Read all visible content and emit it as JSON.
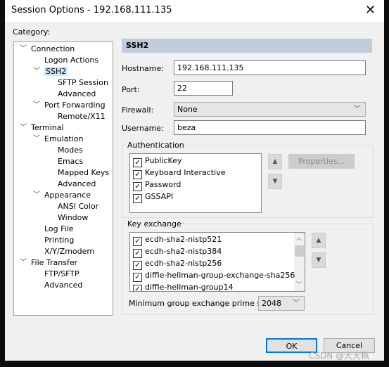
{
  "window": {
    "title": "Session Options - 192.168.111.135",
    "close_icon": "close-icon"
  },
  "category_label": "Category:",
  "tree": [
    {
      "label": "Connection",
      "level": 0,
      "expanded": true
    },
    {
      "label": "Logon Actions",
      "level": 1
    },
    {
      "label": "SSH2",
      "level": 1,
      "expanded": true,
      "selected": true
    },
    {
      "label": "SFTP Session",
      "level": 2
    },
    {
      "label": "Advanced",
      "level": 2
    },
    {
      "label": "Port Forwarding",
      "level": 1,
      "expanded": true
    },
    {
      "label": "Remote/X11",
      "level": 2
    },
    {
      "label": "Terminal",
      "level": 0,
      "expanded": true
    },
    {
      "label": "Emulation",
      "level": 1,
      "expanded": true
    },
    {
      "label": "Modes",
      "level": 2
    },
    {
      "label": "Emacs",
      "level": 2
    },
    {
      "label": "Mapped Keys",
      "level": 2
    },
    {
      "label": "Advanced",
      "level": 2
    },
    {
      "label": "Appearance",
      "level": 1,
      "expanded": true
    },
    {
      "label": "ANSI Color",
      "level": 2
    },
    {
      "label": "Window",
      "level": 2
    },
    {
      "label": "Log File",
      "level": 1
    },
    {
      "label": "Printing",
      "level": 1
    },
    {
      "label": "X/Y/Zmodem",
      "level": 1
    },
    {
      "label": "File Transfer",
      "level": 0,
      "expanded": true
    },
    {
      "label": "FTP/SFTP",
      "level": 1
    },
    {
      "label": "Advanced",
      "level": 1
    }
  ],
  "panel": {
    "header": "SSH2",
    "hostname_label": "Hostname:",
    "hostname": "192.168.111.135",
    "port_label": "Port:",
    "port": "22",
    "firewall_label": "Firewall:",
    "firewall": "None",
    "username_label": "Username:",
    "username": "beza",
    "auth": {
      "label": "Authentication",
      "items": [
        {
          "label": "PublicKey",
          "checked": true
        },
        {
          "label": "Keyboard Interactive",
          "checked": true
        },
        {
          "label": "Password",
          "checked": true
        },
        {
          "label": "GSSAPI",
          "checked": true
        }
      ],
      "properties_label": "Properties..."
    },
    "kex": {
      "label": "Key exchange",
      "items": [
        {
          "label": "ecdh-sha2-nistp521",
          "checked": true
        },
        {
          "label": "ecdh-sha2-nistp384",
          "checked": true
        },
        {
          "label": "ecdh-sha2-nistp256",
          "checked": true
        },
        {
          "label": "diffie-hellman-group-exchange-sha256",
          "checked": true
        },
        {
          "label": "diffie-hellman-group14",
          "checked": true
        }
      ],
      "min_prime_label": "Minimum group exchange prime size:",
      "min_prime": "2048"
    }
  },
  "buttons": {
    "ok": "OK",
    "cancel": "Cancel"
  },
  "watermark": "CSDN @大大枫"
}
